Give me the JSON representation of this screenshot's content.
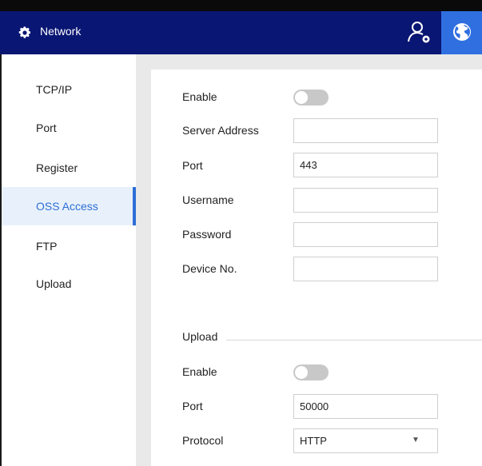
{
  "header": {
    "title": "Network",
    "title_icon": "gear-icon",
    "user_icon": "user-settings-icon",
    "globe_icon": "globe-icon",
    "colors": {
      "bar": "#0a1673",
      "active_button": "#2f6fe0"
    }
  },
  "sidebar": {
    "items": [
      {
        "label": "TCP/IP"
      },
      {
        "label": "Port"
      },
      {
        "label": "Register"
      },
      {
        "label": "OSS Access",
        "active": true
      },
      {
        "label": "FTP"
      },
      {
        "label": "Upload"
      }
    ],
    "active_color": "#2d6fd6"
  },
  "form": {
    "enable_label": "Enable",
    "enable_on": false,
    "server_address_label": "Server Address",
    "server_address_value": "",
    "port_label": "Port",
    "port_value": "443",
    "username_label": "Username",
    "username_value": "",
    "password_label": "Password",
    "password_value": "",
    "device_no_label": "Device No.",
    "device_no_value": ""
  },
  "upload": {
    "section_title": "Upload",
    "enable_label": "Enable",
    "enable_on": false,
    "port_label": "Port",
    "port_value": "50000",
    "protocol_label": "Protocol",
    "protocol_value": "HTTP"
  }
}
